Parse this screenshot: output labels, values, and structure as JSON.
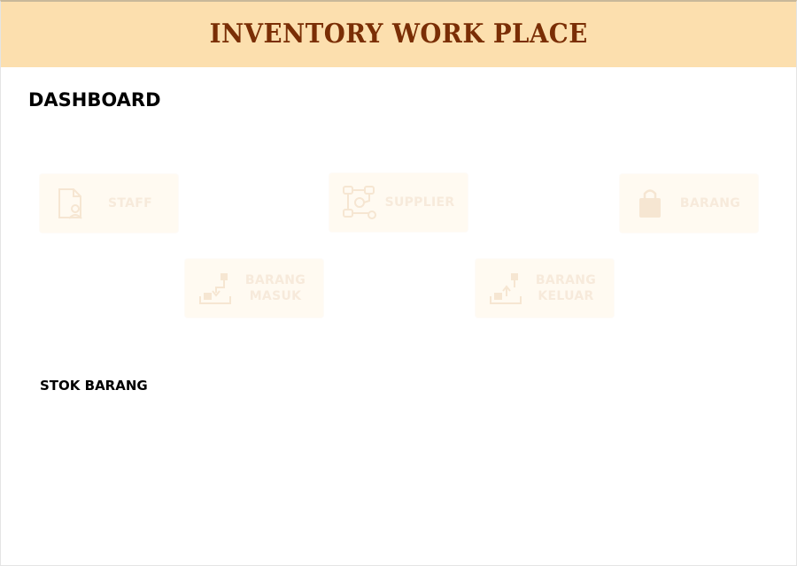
{
  "header": {
    "title": "INVENTORY WORK PLACE"
  },
  "dashboard": {
    "title": "DASHBOARD",
    "tiles": [
      {
        "label": "STAFF",
        "icon": "staff-document-user-icon"
      },
      {
        "label": "SUPPLIER",
        "icon": "supplier-network-icon"
      },
      {
        "label": "BARANG",
        "icon": "shopping-bag-icon"
      },
      {
        "label": "BARANG MASUK",
        "icon": "box-inbound-icon"
      },
      {
        "label": "BARANG KELUAR",
        "icon": "box-outbound-icon"
      }
    ]
  },
  "stok": {
    "title": "STOK BARANG"
  },
  "colors": {
    "header_bg": "#fcdfae",
    "header_text": "#7a2e05",
    "tile_bg": "#fffaf1",
    "tile_fg": "#f7eadb"
  }
}
